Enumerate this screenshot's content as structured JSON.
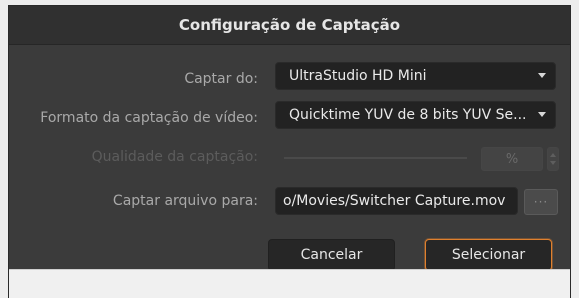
{
  "dialog": {
    "title": "Configuração de Captação"
  },
  "capture_from": {
    "label": "Captar do:",
    "value": "UltraStudio HD Mini"
  },
  "video_format": {
    "label": "Formato da captação de vídeo:",
    "value": "Quicktime YUV de 8 bits YUV Se..."
  },
  "quality": {
    "label": "Qualidade da captação:",
    "unit": "%"
  },
  "capture_file": {
    "label": "Captar arquivo para:",
    "path": "o/Movies/Switcher Capture.mov",
    "browse_label": "···"
  },
  "buttons": {
    "cancel": "Cancelar",
    "select": "Selecionar"
  },
  "colors": {
    "dialog_bg": "#3b3b3b",
    "field_bg": "#222222",
    "accent": "#e0802e"
  },
  "icons": {
    "dropdown": "caret-down-icon",
    "stepper": "up-down-arrows-icon"
  }
}
